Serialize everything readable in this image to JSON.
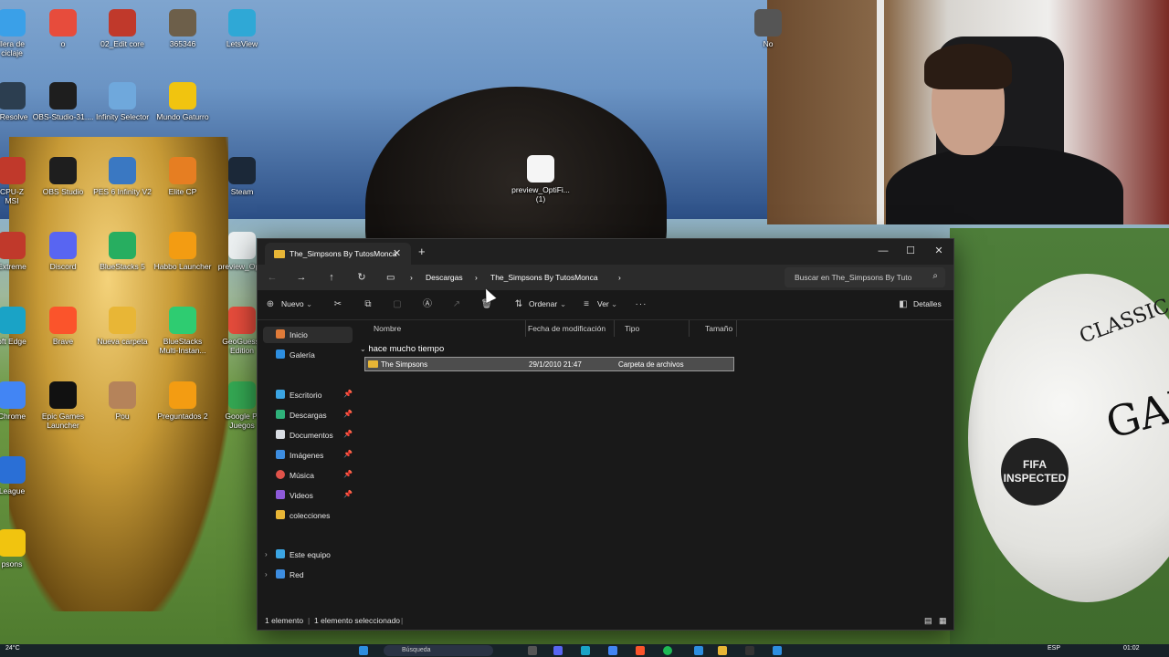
{
  "desktop": {
    "icons": [
      {
        "label": "llera de\nciclaje",
        "color": "#3aa0e8"
      },
      {
        "label": "o",
        "color": "#e74c3c"
      },
      {
        "label": "02_Edit core",
        "color": "#c0392b"
      },
      {
        "label": "365346",
        "color": "#6d5f4a"
      },
      {
        "label": "LetsView",
        "color": "#2fa8d6"
      },
      {
        "label": "i Resolve",
        "color": "#2c3e50"
      },
      {
        "label": "OBS-Studio-31....",
        "color": "#1e1e1e"
      },
      {
        "label": "Infinity Selector",
        "color": "#6fa8dc"
      },
      {
        "label": "Mundo Gaturro",
        "color": "#f1c40f"
      },
      {
        "label": "CPU-Z\nMSI",
        "color": "#c0392b"
      },
      {
        "label": "OBS Studio",
        "color": "#1e1e1e"
      },
      {
        "label": "PES 6 Infinity V2",
        "color": "#3a78c2"
      },
      {
        "label": "Elite CP",
        "color": "#e67e22"
      },
      {
        "label": "Steam",
        "color": "#1b2838"
      },
      {
        "label": "Extreme",
        "color": "#c0392b"
      },
      {
        "label": "Discord",
        "color": "#5865f2"
      },
      {
        "label": "BlueStacks 5",
        "color": "#27ae60"
      },
      {
        "label": "Habbo Launcher",
        "color": "#f39c12"
      },
      {
        "label": "preview_Op...",
        "color": "#ecf0f1"
      },
      {
        "label": "oft Edge",
        "color": "#1aa3c6"
      },
      {
        "label": "Brave",
        "color": "#fb542b"
      },
      {
        "label": "Nueva carpeta",
        "color": "#e8b636"
      },
      {
        "label": "BlueStacks\nMulti-Instan...",
        "color": "#2ecc71"
      },
      {
        "label": "GeoGuessr\nEdition",
        "color": "#e74c3c"
      },
      {
        "label": "Chrome",
        "color": "#4285f4"
      },
      {
        "label": "Epic Games\nLauncher",
        "color": "#111111"
      },
      {
        "label": "Pou",
        "color": "#b5835a"
      },
      {
        "label": "Preguntados 2",
        "color": "#f39c12"
      },
      {
        "label": "Google Pl\nJuegos",
        "color": "#34a853"
      },
      {
        "label": "League",
        "color": "#2a6fd6"
      },
      {
        "label": "psons",
        "color": "#f1c40f"
      },
      {
        "label": "No",
        "color": "#555555"
      }
    ],
    "center_icon": {
      "label": "preview_OptiFi...\n(1)",
      "color": "#f5f5f5"
    }
  },
  "explorer": {
    "tab_title": "The_Simpsons By TutosMonca",
    "nav": {
      "breadcrumb": [
        "Descargas",
        "The_Simpsons By TutosMonca"
      ]
    },
    "search_placeholder": "Buscar en The_Simpsons By Tuto",
    "toolbar": {
      "new": "Nuevo",
      "sort": "Ordenar",
      "view": "Ver",
      "details": "Detalles"
    },
    "sidebar": {
      "home": "Inicio",
      "gallery": "Galería",
      "quick": [
        "Escritorio",
        "Descargas",
        "Documentos",
        "Imágenes",
        "Música",
        "Videos",
        "colecciones"
      ],
      "this_pc": "Este equipo",
      "network": "Red"
    },
    "columns": [
      "Nombre",
      "Fecha de modificación",
      "Tipo",
      "Tamaño"
    ],
    "group_label": "hace mucho tiempo",
    "rows": [
      {
        "name": "The Simpsons",
        "date": "29/1/2010 21:47",
        "type": "Carpeta de archivos",
        "size": ""
      }
    ],
    "status": {
      "count": "1 elemento",
      "selected": "1 elemento seleccionado"
    }
  },
  "taskbar": {
    "weather": "24°C",
    "search_placeholder": "Búsqueda",
    "lang": "ESP",
    "time": "01:02"
  }
}
